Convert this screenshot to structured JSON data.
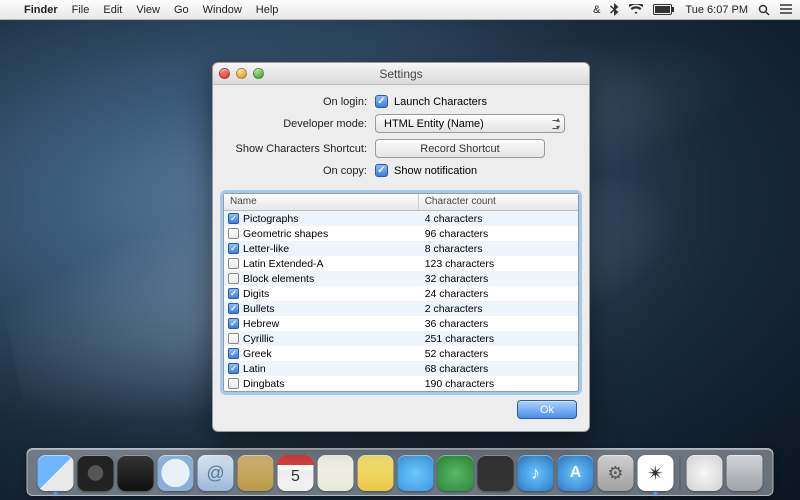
{
  "menubar": {
    "app": "Finder",
    "items": [
      "File",
      "Edit",
      "View",
      "Go",
      "Window",
      "Help"
    ],
    "clock": "Tue 6:07 PM"
  },
  "window": {
    "title": "Settings",
    "labels": {
      "on_login": "On login:",
      "developer_mode": "Developer mode:",
      "shortcut": "Show Characters Shortcut:",
      "on_copy": "On copy:"
    },
    "values": {
      "launch_characters": "Launch Characters",
      "developer_mode_value": "HTML Entity (Name)",
      "record_shortcut": "Record Shortcut",
      "show_notification": "Show notification"
    },
    "table": {
      "headers": {
        "name": "Name",
        "count": "Character count"
      },
      "rows": [
        {
          "checked": true,
          "name": "Pictographs",
          "count": "4 characters"
        },
        {
          "checked": false,
          "name": "Geometric shapes",
          "count": "96 characters"
        },
        {
          "checked": true,
          "name": "Letter-like",
          "count": "8 characters"
        },
        {
          "checked": false,
          "name": "Latin Extended-A",
          "count": "123 characters"
        },
        {
          "checked": false,
          "name": "Block elements",
          "count": "32 characters"
        },
        {
          "checked": true,
          "name": "Digits",
          "count": "24 characters"
        },
        {
          "checked": true,
          "name": "Bullets",
          "count": "2 characters"
        },
        {
          "checked": true,
          "name": "Hebrew",
          "count": "36 characters"
        },
        {
          "checked": false,
          "name": "Cyrillic",
          "count": "251 characters"
        },
        {
          "checked": true,
          "name": "Greek",
          "count": "52 characters"
        },
        {
          "checked": true,
          "name": "Latin",
          "count": "68 characters"
        },
        {
          "checked": false,
          "name": "Dingbats",
          "count": "190 characters"
        }
      ]
    },
    "ok_button": "Ok"
  },
  "dock": {
    "items": [
      {
        "name": "finder",
        "running": true
      },
      {
        "name": "launchpad"
      },
      {
        "name": "mission-control"
      },
      {
        "name": "safari"
      },
      {
        "name": "mail"
      },
      {
        "name": "contacts"
      },
      {
        "name": "calendar"
      },
      {
        "name": "reminders"
      },
      {
        "name": "notes"
      },
      {
        "name": "messages"
      },
      {
        "name": "facetime"
      },
      {
        "name": "photo-booth"
      },
      {
        "name": "itunes"
      },
      {
        "name": "app-store"
      },
      {
        "name": "system-preferences"
      },
      {
        "name": "characters",
        "running": true
      }
    ],
    "right": [
      {
        "name": "downloads"
      },
      {
        "name": "trash"
      }
    ]
  }
}
